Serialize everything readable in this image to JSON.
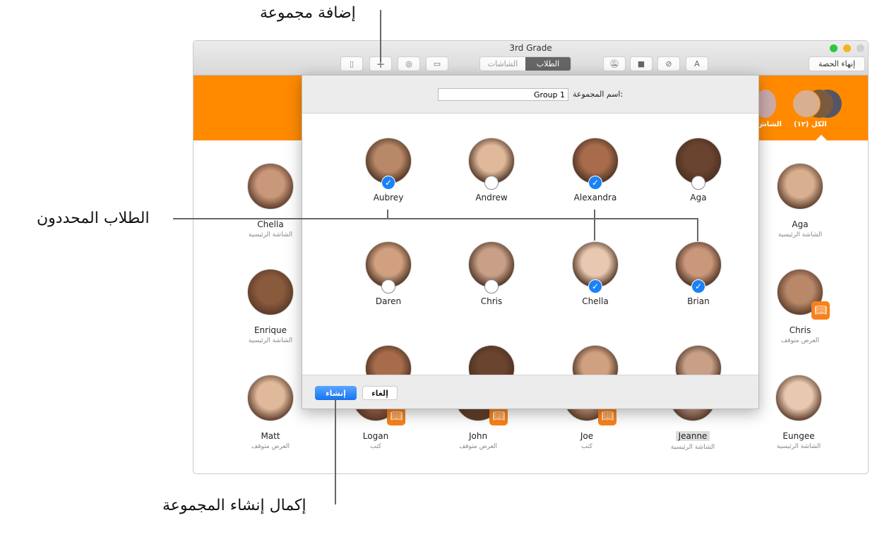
{
  "annotations": {
    "add_group": "إضافة مجموعة",
    "selected_students": "الطلاب المحددون",
    "finish_group": "إكمال إنشاء المجموعة"
  },
  "window": {
    "title": "3rd Grade",
    "end_class": "إنهاء الحصة",
    "tabs": [
      {
        "label": "الطلاب",
        "active": true
      },
      {
        "label": "الشاشات",
        "active": false
      }
    ],
    "toolbar_icons": [
      "device-icon",
      "plus-icon",
      "add-person-icon",
      "airplay-icon",
      "mute-icon",
      "lock-icon",
      "compass-icon",
      "app-store-icon"
    ]
  },
  "groups": {
    "all_label": "الكل (١٢)",
    "screens_label": "الشاش"
  },
  "dialog": {
    "name_label": "اسم المجموعة:",
    "name_value": "Group 1",
    "create": "إنشاء",
    "cancel": "إلغاء",
    "students": [
      {
        "name": "Aubrey",
        "checked": true
      },
      {
        "name": "Andrew",
        "checked": false
      },
      {
        "name": "Alexandra",
        "checked": true
      },
      {
        "name": "Aga",
        "checked": false
      },
      {
        "name": "Daren",
        "checked": false
      },
      {
        "name": "Chris",
        "checked": false
      },
      {
        "name": "Chella",
        "checked": true
      },
      {
        "name": "Brian",
        "checked": true
      }
    ]
  },
  "students": [
    {
      "name": "Chella",
      "status": "الشاشة الرئيسية"
    },
    {
      "name": "Aga",
      "status": "الشاشة الرئيسية"
    },
    {
      "name": "Enrique",
      "status": "الشاشة الرئيسية"
    },
    {
      "name": "Chris",
      "status": "العرض متوقف"
    },
    {
      "name": "Matt",
      "status": "العرض متوقف"
    },
    {
      "name": "Logan",
      "status": "كتب"
    },
    {
      "name": "John",
      "status": "العرض متوقف"
    },
    {
      "name": "Joe",
      "status": "كتب"
    },
    {
      "name": "Jeanne",
      "status": "الشاشة الرئيسية"
    },
    {
      "name": "Eungee",
      "status": "الشاشة الرئيسية"
    }
  ],
  "colors": {
    "accent": "#ff8a00",
    "selected": "#1a82f7",
    "books": "#f7821b"
  }
}
